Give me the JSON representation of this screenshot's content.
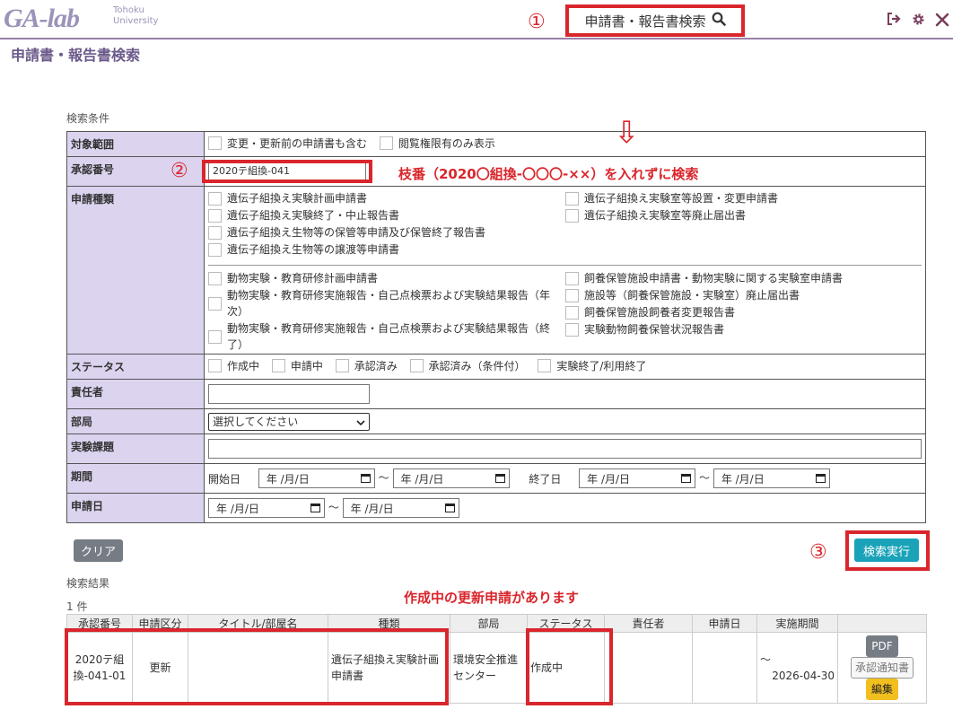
{
  "header": {
    "logo_text": "GA-lab",
    "logo_sub1": "Tohoku",
    "logo_sub2": "University",
    "search_label": "申請書・報告書検索",
    "page_title": "申請書・報告書検索"
  },
  "annotations": {
    "circle1": "①",
    "circle2": "②",
    "circle3": "③",
    "arrow": "⇩",
    "note_branch": "枝番（2020〇組換-〇〇〇-××）を入れずに検索",
    "note_result": "作成中の更新申請があります"
  },
  "conditions": {
    "section_label": "検索条件",
    "scope": {
      "label": "対象範囲",
      "options": [
        "変更・更新前の申請書も含む",
        "閲覧権限有のみ表示"
      ]
    },
    "approval_no": {
      "label": "承認番号",
      "value": "2020テ組換-041"
    },
    "app_type": {
      "label": "申請種類",
      "group1_left": [
        "遺伝子組換え実験計画申請書",
        "遺伝子組換え実験終了・中止報告書",
        "遺伝子組換え生物等の保管等申請及び保管終了報告書",
        "遺伝子組換え生物等の譲渡等申請書"
      ],
      "group1_right": [
        "遺伝子組換え実験室等設置・変更申請書",
        "遺伝子組換え実験室等廃止届出書"
      ],
      "group2_left": [
        "動物実験・教育研修計画申請書",
        "動物実験・教育研修実施報告・自己点検票および実験結果報告（年次）",
        "動物実験・教育研修実施報告・自己点検票および実験結果報告（終了）"
      ],
      "group2_right": [
        "飼養保管施設申請書・動物実験に関する実験室申請書",
        "施設等（飼養保管施設・実験室）廃止届出書",
        "飼養保管施設飼養者変更報告書",
        "実験動物飼養保管状況報告書"
      ]
    },
    "status": {
      "label": "ステータス",
      "options": [
        "作成中",
        "申請中",
        "承認済み",
        "承認済み（条件付）",
        "実験終了/利用終了"
      ]
    },
    "responsible": {
      "label": "責任者",
      "value": ""
    },
    "department": {
      "label": "部局",
      "selected": "選択してください"
    },
    "project": {
      "label": "実験課題",
      "value": ""
    },
    "period": {
      "label": "期間",
      "start_label": "開始日",
      "end_label": "終了日",
      "date_placeholder": "年 /月/日",
      "tilde": "～"
    },
    "apply_date": {
      "label": "申請日"
    }
  },
  "buttons": {
    "clear": "クリア",
    "search": "検索実行"
  },
  "results": {
    "section_label": "検索結果",
    "count": "1 件",
    "columns": [
      "承認番号",
      "申請区分",
      "タイトル/部屋名",
      "種類",
      "部局",
      "ステータス",
      "責任者",
      "申請日",
      "実施期間"
    ],
    "row": {
      "approval_no": "2020テ組換-041-01",
      "category": "更新",
      "title": "",
      "type": "遺伝子組換え実験計画申請書",
      "department": "環境安全推進センター",
      "status": "作成中",
      "responsible": "",
      "apply_date": "",
      "period_tilde": "～",
      "period_end": "2026-04-30",
      "btn_pdf": "PDF",
      "btn_notice": "承認通知書",
      "btn_edit": "編集"
    }
  },
  "icons": {
    "logout": "logout-icon",
    "settings": "gear-icon",
    "tools": "tools-icon",
    "search": "search-icon",
    "calendar": "calendar-icon"
  },
  "colors": {
    "accent_red": "#d9262c",
    "label_bg": "#dcd3ef",
    "search_btn": "#1aa3b8",
    "edit_btn": "#f2c01e",
    "title_purple": "#6b5a8a"
  }
}
